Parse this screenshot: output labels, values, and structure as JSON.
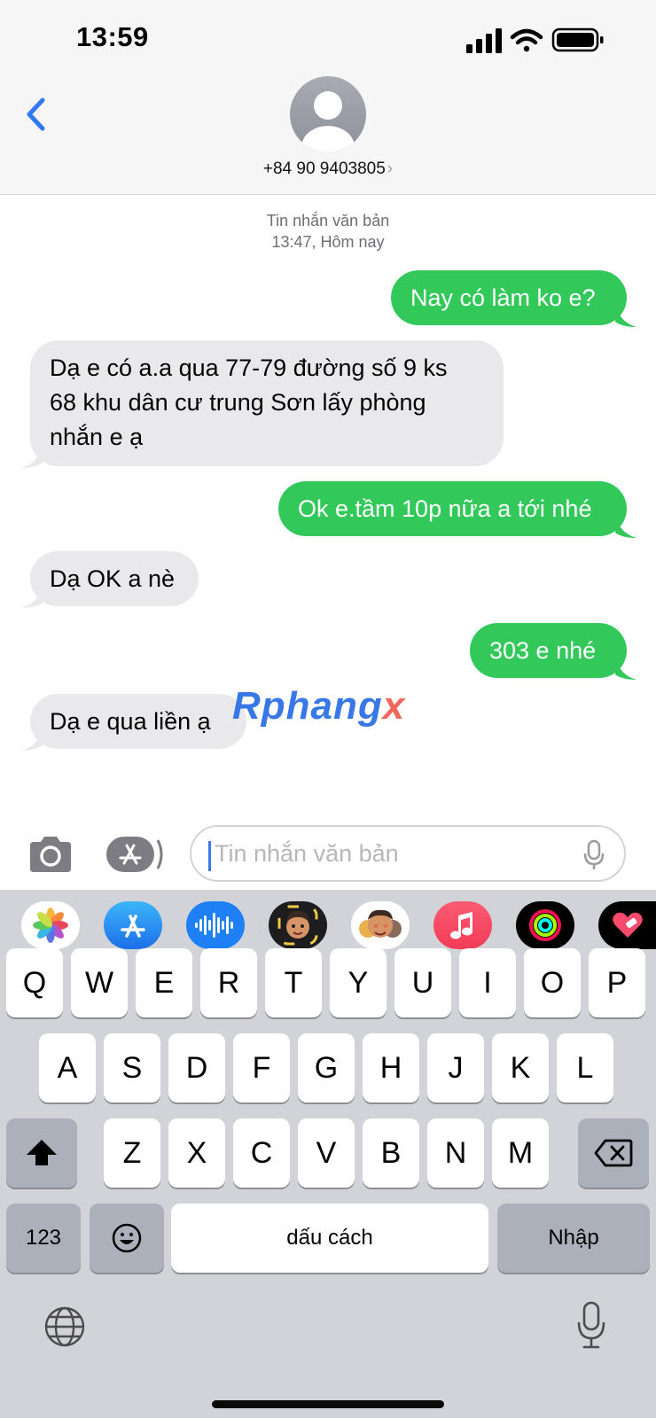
{
  "status_bar": {
    "time": "13:59"
  },
  "header": {
    "contact": "+84 90 9403805",
    "chevron": "›"
  },
  "conversation": {
    "meta_label": "Tin nhắn văn bản",
    "meta_time": "13:47, Hôm nay",
    "messages": [
      {
        "direction": "outgoing",
        "text": "Nay có làm ko e?"
      },
      {
        "direction": "incoming",
        "lines": [
          "Dạ e có a.a qua 77-79 đường số 9 ks",
          "68 khu dân cư trung Sơn lấy phòng",
          "nhắn e ạ"
        ]
      },
      {
        "direction": "outgoing",
        "text": "Ok e.tầm 10p nữa a tới nhé"
      },
      {
        "direction": "incoming",
        "text": "Dạ OK a nè"
      },
      {
        "direction": "outgoing",
        "text": "303 e nhé"
      },
      {
        "direction": "incoming",
        "text": "Dạ e qua liền ạ"
      }
    ]
  },
  "watermark": {
    "part1": "Rphang",
    "part2": "x"
  },
  "input": {
    "placeholder": "Tin nhắn văn bản"
  },
  "app_strip": {
    "icons": [
      "photos-icon",
      "app-store-icon",
      "audio-message-icon",
      "memoji-icon",
      "memoji-stickers-icon",
      "music-icon",
      "activity-icon",
      "digital-touch-icon"
    ]
  },
  "keyboard": {
    "row1": [
      "Q",
      "W",
      "E",
      "R",
      "T",
      "Y",
      "U",
      "I",
      "O",
      "P"
    ],
    "row2": [
      "A",
      "S",
      "D",
      "F",
      "G",
      "H",
      "J",
      "K",
      "L"
    ],
    "row3": [
      "Z",
      "X",
      "C",
      "V",
      "B",
      "N",
      "M"
    ],
    "numbers_key": "123",
    "space_key": "dấu cách",
    "return_key": "Nhập"
  },
  "colors": {
    "outgoing_bubble": "#33c95a",
    "incoming_bubble": "#e9e9eb",
    "accent": "#3478f6"
  }
}
